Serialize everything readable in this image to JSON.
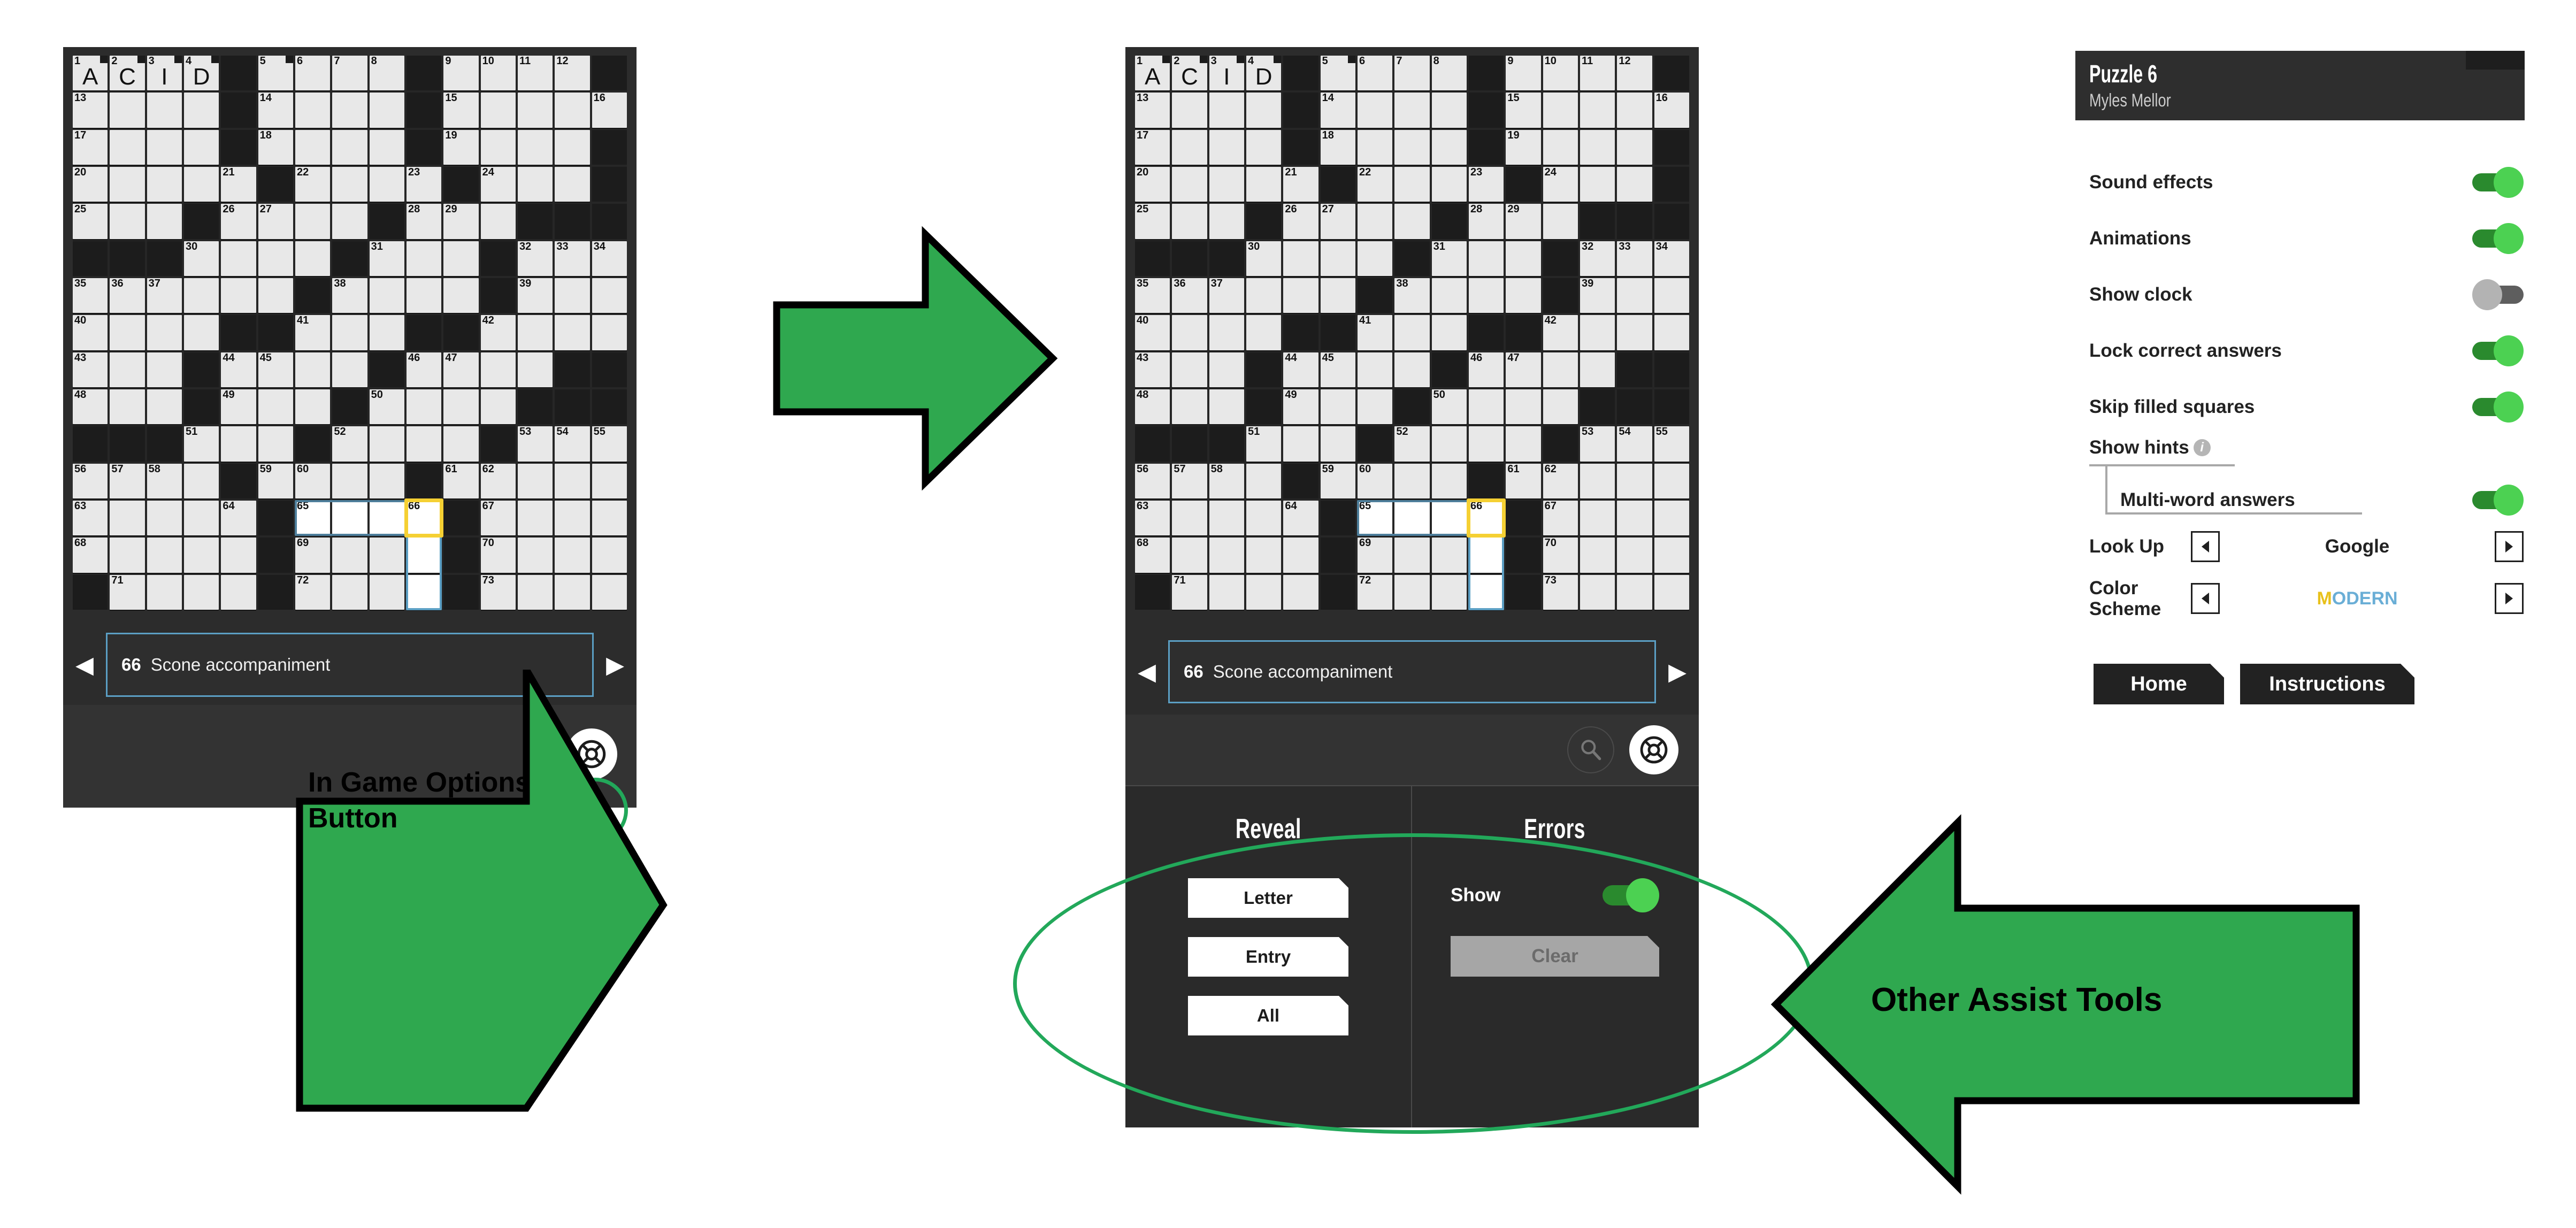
{
  "puzzle": {
    "grid_size": 15,
    "letters": {
      "0,0": "A",
      "0,1": "C",
      "0,2": "I",
      "0,3": "D"
    },
    "circled_cells": [
      "0,0",
      "0,1",
      "0,2",
      "0,3",
      "0,5"
    ],
    "black_cells": [
      "0,4",
      "0,9",
      "0,14",
      "1,4",
      "1,9",
      "2,4",
      "2,9",
      "2,14",
      "3,5",
      "3,10",
      "3,14",
      "4,3",
      "4,8",
      "4,12",
      "4,13",
      "4,14",
      "5,0",
      "5,1",
      "5,2",
      "5,7",
      "5,11",
      "6,6",
      "6,11",
      "7,4",
      "7,5",
      "7,9",
      "7,10",
      "8,3",
      "8,8",
      "8,13",
      "8,14",
      "9,3",
      "9,7",
      "9,12",
      "9,13",
      "9,14",
      "10,0",
      "10,1",
      "10,2",
      "10,6",
      "10,11",
      "11,4",
      "11,9",
      "12,5",
      "12,10",
      "13,5",
      "13,10",
      "14,0",
      "14,5",
      "14,10"
    ],
    "numbers": {
      "0,0": "1",
      "0,1": "2",
      "0,2": "3",
      "0,3": "4",
      "0,5": "5",
      "0,6": "6",
      "0,7": "7",
      "0,8": "8",
      "0,10": "9",
      "0,11": "10",
      "0,12": "11",
      "0,13": "12",
      "1,0": "13",
      "1,5": "14",
      "1,10": "15",
      "1,14": "16",
      "2,0": "17",
      "2,5": "18",
      "2,10": "19",
      "3,0": "20",
      "3,4": "21",
      "3,6": "22",
      "3,9": "23",
      "3,11": "24",
      "4,0": "25",
      "4,4": "26",
      "4,5": "27",
      "4,9": "28",
      "4,10": "29",
      "5,3": "30",
      "5,8": "31",
      "5,12": "32",
      "5,13": "33",
      "5,14": "34",
      "6,0": "35",
      "6,1": "36",
      "6,2": "37",
      "6,7": "38",
      "6,12": "39",
      "7,0": "40",
      "7,6": "41",
      "7,11": "42",
      "8,0": "43",
      "8,4": "44",
      "8,5": "45",
      "8,9": "46",
      "8,10": "47",
      "9,0": "48",
      "9,4": "49",
      "9,8": "50",
      "10,3": "51",
      "10,7": "52",
      "10,12": "53",
      "10,13": "54",
      "10,14": "55",
      "11,0": "56",
      "11,1": "57",
      "11,2": "58",
      "11,5": "59",
      "11,6": "60",
      "11,10": "61",
      "11,11": "62",
      "12,0": "63",
      "12,4": "64",
      "12,6": "65",
      "12,9": "66",
      "12,11": "67",
      "13,0": "68",
      "13,6": "69",
      "13,11": "70",
      "14,1": "71",
      "14,6": "72",
      "14,11": "73"
    },
    "cursor_cell": "12,9",
    "word_across_cells": [
      "12,6",
      "12,7",
      "12,8",
      "12,9"
    ],
    "word_down_cells": [
      "12,9",
      "13,9",
      "14,9"
    ]
  },
  "clue": {
    "number": "66",
    "text": "Scone accompaniment",
    "prev_icon": "left-triangle-icon",
    "next_icon": "right-triangle-icon"
  },
  "toolbar": {
    "search_icon": "magnifier-icon",
    "options_icon": "lifebuoy-icon"
  },
  "assist": {
    "reveal": {
      "title": "Reveal",
      "buttons": [
        "Letter",
        "Entry",
        "All"
      ]
    },
    "errors": {
      "title": "Errors",
      "show_label": "Show",
      "show_enabled": true,
      "clear_label": "Clear",
      "clear_disabled": true
    }
  },
  "settings": {
    "title": "Puzzle 6",
    "author": "Myles Mellor",
    "toggles": [
      {
        "label": "Sound effects",
        "on": true
      },
      {
        "label": "Animations",
        "on": true
      },
      {
        "label": "Show clock",
        "on": false
      },
      {
        "label": "Lock correct answers",
        "on": true
      },
      {
        "label": "Skip filled squares",
        "on": true
      }
    ],
    "hints": {
      "label": "Show hints",
      "info_icon": "info-icon",
      "info_glyph": "i",
      "sub_label": "Multi-word answers",
      "sub_on": true
    },
    "selectors": [
      {
        "label": "Look Up",
        "value": "Google",
        "prev_icon": "left-triangle-icon",
        "next_icon": "right-triangle-icon"
      },
      {
        "label": "Color\nScheme",
        "value": "MODERN",
        "value_first_char": "M",
        "value_rest": "ODERN",
        "color_first": "#e8c11c",
        "color_rest": "#6aaed6",
        "prev_icon": "left-triangle-icon",
        "next_icon": "right-triangle-icon"
      }
    ],
    "buttons": [
      {
        "label": "Home"
      },
      {
        "label": "Instructions"
      }
    ]
  },
  "annotations": [
    {
      "id": "options-callout",
      "text": "In Game Options\nButton"
    },
    {
      "id": "assist-callout",
      "text": "Other Assist Tools"
    }
  ],
  "colors": {
    "accent_green": "#22a85a",
    "arrow_green": "#2fa84f",
    "toggle_on_track": "#2a8a2e",
    "toggle_on_knob": "#4cd152",
    "toggle_off_track": "#5e5e5e",
    "toggle_off_knob": "#b3b3b3",
    "cursor_yellow": "#f5d033",
    "word_blue": "#5b9fc4",
    "panel_bg": "#2c2c2c",
    "cell_open": "#e8e8e8",
    "cell_block": "#1c1c1c"
  }
}
